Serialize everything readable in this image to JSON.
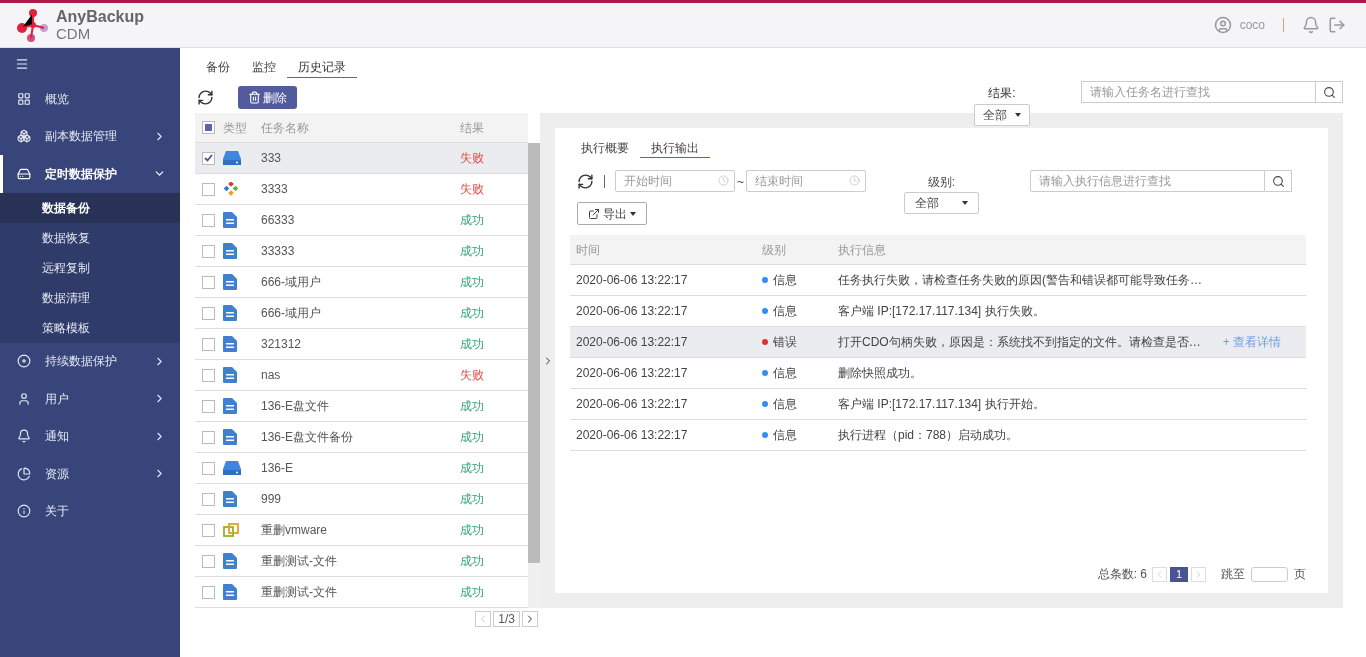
{
  "header": {
    "brand": "AnyBackup",
    "product": "CDM",
    "user": "coco"
  },
  "sidebar": {
    "items": [
      {
        "label": "概览",
        "kind": "link",
        "selected": false
      },
      {
        "label": "副本数据管理",
        "kind": "group",
        "expanded": false,
        "selected": false
      },
      {
        "label": "定时数据保护",
        "kind": "group",
        "expanded": true,
        "selected": true,
        "children": [
          {
            "label": "数据备份",
            "selected": true
          },
          {
            "label": "数据恢复",
            "selected": false
          },
          {
            "label": "远程复制",
            "selected": false
          },
          {
            "label": "数据清理",
            "selected": false
          },
          {
            "label": "策略模板",
            "selected": false
          }
        ]
      },
      {
        "label": "持续数据保护",
        "kind": "group",
        "expanded": false,
        "selected": false
      },
      {
        "label": "用户",
        "kind": "group",
        "expanded": false,
        "selected": false
      },
      {
        "label": "通知",
        "kind": "group",
        "expanded": false,
        "selected": false
      },
      {
        "label": "资源",
        "kind": "group",
        "expanded": false,
        "selected": false
      },
      {
        "label": "关于",
        "kind": "link",
        "selected": false
      }
    ]
  },
  "tabs": [
    {
      "label": "备份",
      "selected": false
    },
    {
      "label": "监控",
      "selected": false
    },
    {
      "label": "历史记录",
      "selected": true
    }
  ],
  "toolbar": {
    "delete": "删除"
  },
  "filter": {
    "label": "结果:",
    "value": "全部",
    "search_placeholder": "请输入任务名进行查找"
  },
  "table": {
    "columns": [
      "类型",
      "任务名称",
      "结果"
    ],
    "select_all_partial": true,
    "rows": [
      {
        "kind": "disk",
        "name": "333",
        "result": "失败",
        "failed": true,
        "checked": true,
        "selected": true
      },
      {
        "kind": "app",
        "name": "3333",
        "result": "失败",
        "failed": true,
        "checked": false,
        "selected": false
      },
      {
        "kind": "file",
        "name": "66333",
        "result": "成功",
        "failed": false,
        "checked": false,
        "selected": false
      },
      {
        "kind": "file",
        "name": "33333",
        "result": "成功",
        "failed": false,
        "checked": false,
        "selected": false
      },
      {
        "kind": "file",
        "name": "666-域用户",
        "result": "成功",
        "failed": false,
        "checked": false,
        "selected": false
      },
      {
        "kind": "file",
        "name": "666-域用户",
        "result": "成功",
        "failed": false,
        "checked": false,
        "selected": false
      },
      {
        "kind": "file",
        "name": "321312",
        "result": "成功",
        "failed": false,
        "checked": false,
        "selected": false
      },
      {
        "kind": "file",
        "name": "nas",
        "result": "失败",
        "failed": true,
        "checked": false,
        "selected": false
      },
      {
        "kind": "file",
        "name": "136-E盘文件",
        "result": "成功",
        "failed": false,
        "checked": false,
        "selected": false
      },
      {
        "kind": "file",
        "name": "136-E盘文件备份",
        "result": "成功",
        "failed": false,
        "checked": false,
        "selected": false
      },
      {
        "kind": "disk",
        "name": "136-E",
        "result": "成功",
        "failed": false,
        "checked": false,
        "selected": false
      },
      {
        "kind": "file",
        "name": "999",
        "result": "成功",
        "failed": false,
        "checked": false,
        "selected": false
      },
      {
        "kind": "vmware",
        "name": "重删vmware",
        "result": "成功",
        "failed": false,
        "checked": false,
        "selected": false
      },
      {
        "kind": "file",
        "name": "重删测试-文件",
        "result": "成功",
        "failed": false,
        "checked": false,
        "selected": false
      },
      {
        "kind": "file",
        "name": "重删测试-文件",
        "result": "成功",
        "failed": false,
        "checked": false,
        "selected": false
      }
    ],
    "pager": "1/3"
  },
  "detail": {
    "tabs": [
      {
        "label": "执行概要",
        "selected": false
      },
      {
        "label": "执行输出",
        "selected": true
      }
    ],
    "start_placeholder": "开始时间",
    "separator": "~",
    "end_placeholder": "结束时间",
    "level_label": "级别:",
    "level_value": "全部",
    "search_placeholder": "请输入执行信息进行查找",
    "export": "导出",
    "columns": [
      "时间",
      "级别",
      "执行信息"
    ],
    "rows": [
      {
        "time": "2020-06-06 13:22:17",
        "level": "信息",
        "color": "#2f8ff0",
        "message": "任务执行失败，请检查任务失败的原因(警告和错误都可能导致任务…",
        "selected": false
      },
      {
        "time": "2020-06-06 13:22:17",
        "level": "信息",
        "color": "#2f8ff0",
        "message": "客户端 IP:[172.17.117.134] 执行失败。",
        "selected": false
      },
      {
        "time": "2020-06-06 13:22:17",
        "level": "错误",
        "color": "#e0302b",
        "message": "打开CDO句柄失败，原因是：系统找不到指定的文件。请检查是否…",
        "link": "+ 查看详情",
        "selected": true
      },
      {
        "time": "2020-06-06 13:22:17",
        "level": "信息",
        "color": "#2f8ff0",
        "message": "删除快照成功。",
        "selected": false
      },
      {
        "time": "2020-06-06 13:22:17",
        "level": "信息",
        "color": "#2f8ff0",
        "message": "客户端 IP:[172.17.117.134] 执行开始。",
        "selected": false
      },
      {
        "time": "2020-06-06 13:22:17",
        "level": "信息",
        "color": "#2f8ff0",
        "message": "执行进程（pid：788）启动成功。",
        "selected": false
      }
    ],
    "total": "总条数: 6",
    "page": "1",
    "jump_label": "跳至",
    "page_unit": "页"
  }
}
